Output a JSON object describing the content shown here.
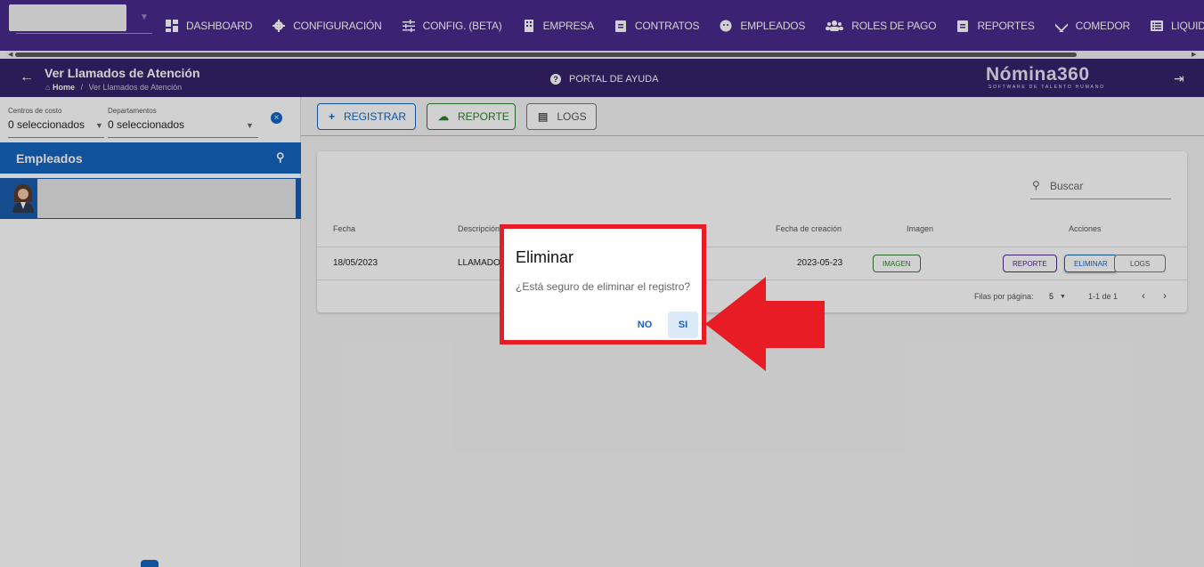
{
  "nav": {
    "items": [
      {
        "label": "DASHBOARD",
        "icon": "dashboard-icon"
      },
      {
        "label": "CONFIGURACIÓN",
        "icon": "gear-icon"
      },
      {
        "label": "CONFIG. (BETA)",
        "icon": "sliders-icon"
      },
      {
        "label": "EMPRESA",
        "icon": "building-icon"
      },
      {
        "label": "CONTRATOS",
        "icon": "clipboard-icon"
      },
      {
        "label": "EMPLEADOS",
        "icon": "face-icon"
      },
      {
        "label": "ROLES DE PAGO",
        "icon": "people-icon"
      },
      {
        "label": "REPORTES",
        "icon": "clipboard-icon"
      },
      {
        "label": "COMEDOR",
        "icon": "utensils-icon"
      },
      {
        "label": "LIQUIDACIONES",
        "icon": "list-icon"
      }
    ]
  },
  "header": {
    "title": "Ver Llamados de Atención",
    "breadcrumb_home": "Home",
    "breadcrumb_sep": "/",
    "breadcrumb_current": "Ver Llamados de Atención",
    "help": "PORTAL DE AYUDA",
    "logo_main": "Nómina360",
    "logo_sub": "SOFTWARE DE TALENTO HUMANO"
  },
  "filters": {
    "cost_label": "Centros de costo",
    "cost_value": "0 seleccionados",
    "dept_label": "Departamentos",
    "dept_value": "0 seleccionados"
  },
  "employees": {
    "title": "Empleados"
  },
  "toolbar": {
    "registrar": "REGISTRAR",
    "reporte": "REPORTE",
    "logs": "LOGS"
  },
  "table": {
    "search_placeholder": "Buscar",
    "headers": {
      "fecha": "Fecha",
      "descripcion": "Descripción",
      "fecha_creacion": "Fecha de creación",
      "imagen": "Imagen",
      "acciones": "Acciones"
    },
    "rows": [
      {
        "fecha": "18/05/2023",
        "descripcion": "LLAMADO",
        "fecha_creacion": "2023-05-23",
        "imagen_btn": "IMAGEN",
        "reporte_btn": "REPORTE",
        "eliminar_btn": "ELIMINAR",
        "logs_btn": "LOGS"
      }
    ],
    "rows_per_page_label": "Filas por página:",
    "rows_per_page": "5",
    "range": "1-1 de 1"
  },
  "dialog": {
    "title": "Eliminar",
    "message": "¿Está seguro de eliminar el registro?",
    "no": "NO",
    "si": "SI"
  },
  "colors": {
    "nav_bg": "#4a2a8c",
    "subheader_bg": "#35226a",
    "primary_blue": "#1565c0",
    "green": "#2e7d32",
    "purple": "#4a2a8c",
    "highlight_red": "#e81c24"
  }
}
